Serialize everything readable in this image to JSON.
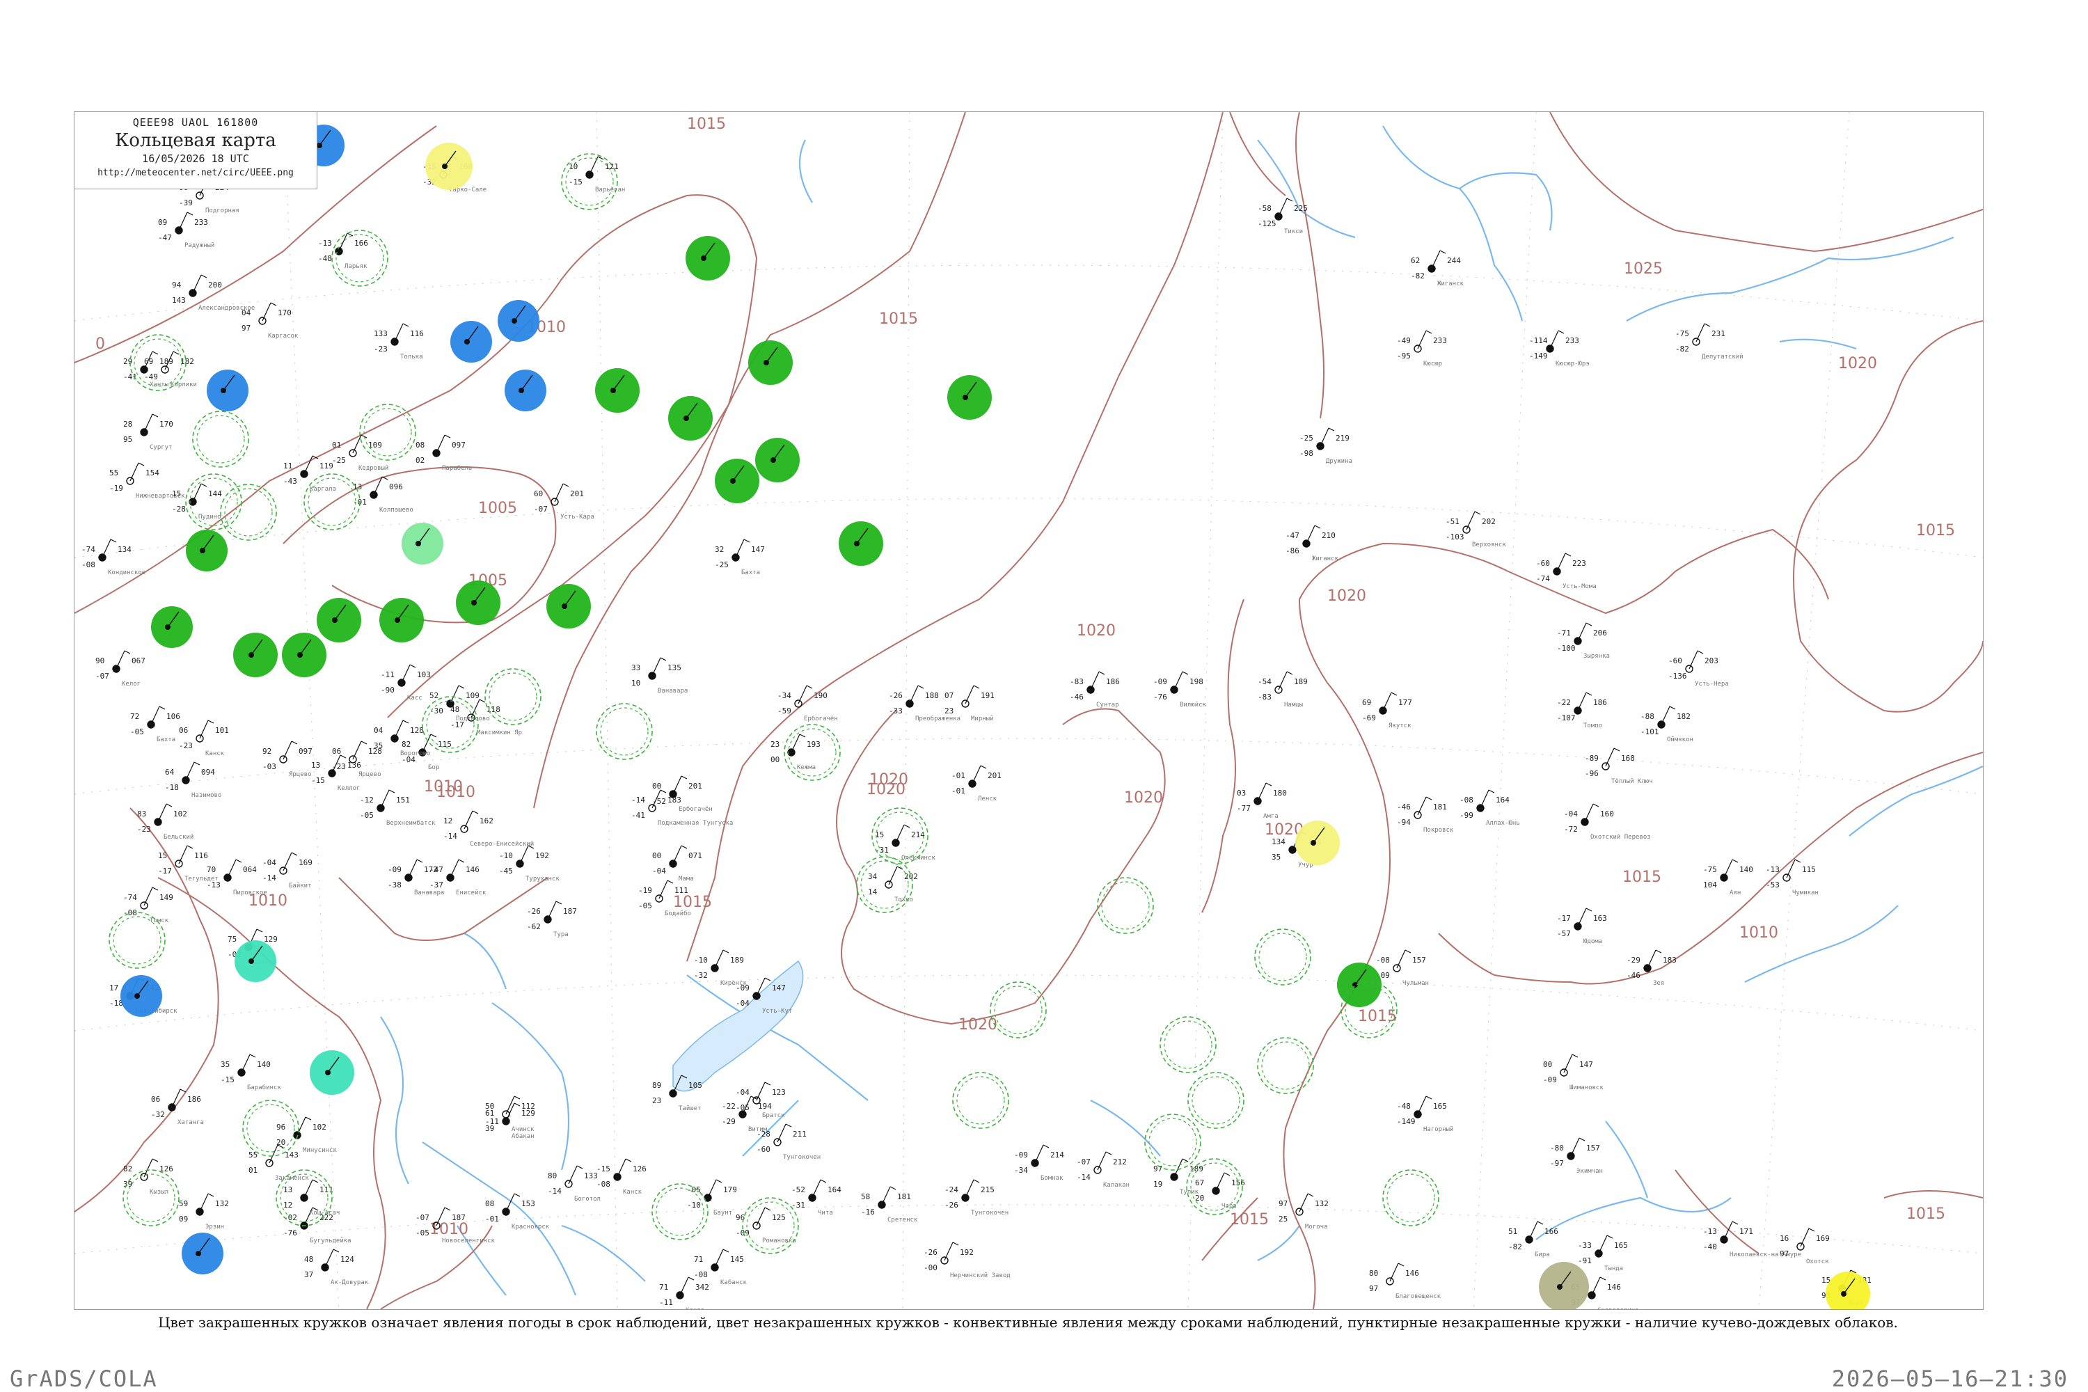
{
  "header": {
    "code": "QEEE98  UAOL  161800",
    "title": "Кольцевая карта",
    "datetime": "16/05/2026 18 UTC",
    "url": "http://meteocenter.net/circ/UEEE.png"
  },
  "caption": "Цвет закрашенных кружков означает явления погоды в срок наблюдений, цвет незакрашенных кружков - конвективные явления между сроками наблюдений, пунктирные незакрашенные кружки - наличие кучево-дождевых облаков.",
  "footer": {
    "left": "GrADS/COLA",
    "right": "2026–05–16–21:30"
  },
  "colors": {
    "isobar": "#b5706a",
    "river": "#7ab8ee",
    "green": "#22b41c",
    "blue": "#2a86e6",
    "teal": "#3ee2b8",
    "light_green": "#7ee89a",
    "yellow": "#f4f27a",
    "bright_yellow": "#f7f22a",
    "olive": "#b4b48a",
    "dashed_ring": "#3cb43c"
  },
  "isobar_labels": [
    "1015",
    "1010",
    "1005",
    "1005",
    "1010",
    "1015",
    "1020",
    "1020",
    "1020",
    "1020",
    "1025",
    "1020",
    "1015",
    "1015",
    "1010",
    "1015",
    "1015",
    "1015",
    "1010",
    "1010",
    "1015",
    "1020",
    "1020",
    "1010",
    "0",
    "1020"
  ],
  "filled_stations": [
    {
      "kind": "green"
    },
    {
      "kind": "green"
    },
    {
      "kind": "green"
    },
    {
      "kind": "green"
    },
    {
      "kind": "green"
    },
    {
      "kind": "green"
    },
    {
      "kind": "green"
    },
    {
      "kind": "green"
    },
    {
      "kind": "green"
    },
    {
      "kind": "green"
    },
    {
      "kind": "green"
    },
    {
      "kind": "green"
    },
    {
      "kind": "green"
    },
    {
      "kind": "green"
    },
    {
      "kind": "green"
    },
    {
      "kind": "green"
    },
    {
      "kind": "green"
    },
    {
      "kind": "blue"
    },
    {
      "kind": "blue"
    },
    {
      "kind": "blue"
    },
    {
      "kind": "blue"
    },
    {
      "kind": "blue"
    },
    {
      "kind": "blue"
    },
    {
      "kind": "blue"
    },
    {
      "kind": "teal"
    },
    {
      "kind": "teal"
    },
    {
      "kind": "light_green"
    },
    {
      "kind": "yellow"
    },
    {
      "kind": "yellow"
    },
    {
      "kind": "bright_yellow"
    },
    {
      "kind": "olive"
    }
  ],
  "ring_stations": [
    {
      "kind": "dashed"
    },
    {
      "kind": "dashed"
    },
    {
      "kind": "dashed"
    },
    {
      "kind": "dashed"
    },
    {
      "kind": "dashed"
    },
    {
      "kind": "dashed"
    },
    {
      "kind": "dashed"
    },
    {
      "kind": "dashed"
    },
    {
      "kind": "dashed"
    },
    {
      "kind": "dashed"
    },
    {
      "kind": "dashed"
    },
    {
      "kind": "dashed"
    },
    {
      "kind": "dashed"
    },
    {
      "kind": "dashed"
    },
    {
      "kind": "dashed"
    },
    {
      "kind": "dashed"
    },
    {
      "kind": "dashed"
    },
    {
      "kind": "dashed"
    },
    {
      "kind": "dashed"
    },
    {
      "kind": "dashed"
    },
    {
      "kind": "dashed"
    },
    {
      "kind": "dashed"
    },
    {
      "kind": "dashed"
    },
    {
      "kind": "dashed"
    },
    {
      "kind": "dashed"
    },
    {
      "kind": "dashed"
    },
    {
      "kind": "dashed"
    },
    {
      "kind": "dashed"
    },
    {
      "kind": "dashed"
    },
    {
      "kind": "dashed"
    },
    {
      "kind": "dashed"
    }
  ],
  "stations": [
    {
      "press": "224",
      "temp": "06",
      "dew": "-39",
      "name": "Подгорная"
    },
    {
      "press": "233",
      "temp": "09",
      "dew": "-47",
      "name": "Радужный"
    },
    {
      "press": "200",
      "temp": "94",
      "dew": "143",
      "name": "Александровское"
    },
    {
      "press": "170",
      "temp": "04",
      "dew": "97",
      "name": "Каргасок"
    },
    {
      "press": "189",
      "temp": "29",
      "dew": "-41",
      "name": "Ханты"
    },
    {
      "press": "170",
      "temp": "28",
      "dew": "95",
      "name": "Сургут"
    },
    {
      "press": "154",
      "temp": "55",
      "dew": "-19",
      "name": "Нижневартовск"
    },
    {
      "press": "134",
      "temp": "-74",
      "dew": "-08",
      "name": "Кондинское"
    },
    {
      "press": "121",
      "temp": "10",
      "dew": "-15",
      "name": "Варьёган"
    },
    {
      "press": "160",
      "temp": "-15",
      "dew": "-32",
      "name": "Тарко-Сале"
    },
    {
      "press": "116",
      "temp": "133",
      "dew": "-23",
      "name": "Толька"
    },
    {
      "press": "166",
      "temp": "-13",
      "dew": "-48",
      "name": "Ларьяк"
    },
    {
      "press": "182",
      "temp": "69",
      "dew": "-49",
      "name": "Корлики"
    },
    {
      "press": "144",
      "temp": "15",
      "dew": "-28",
      "name": "Пудино"
    },
    {
      "press": "119",
      "temp": "11",
      "dew": "-43",
      "name": "Каргала"
    },
    {
      "press": "109",
      "temp": "01",
      "dew": "-25",
      "name": "Кедровый"
    },
    {
      "press": "097",
      "temp": "08",
      "dew": "02",
      "name": "Парабель"
    },
    {
      "press": "096",
      "temp": "13",
      "dew": "-01",
      "name": "Колпашево"
    },
    {
      "press": "201",
      "temp": "60",
      "dew": "-07",
      "name": "Усть-Кара"
    },
    {
      "press": "147",
      "temp": "32",
      "dew": "-25",
      "name": "Бахта"
    },
    {
      "press": "135",
      "temp": "33",
      "dew": "10",
      "name": "Ванавара"
    },
    {
      "press": "190",
      "temp": "-34",
      "dew": "-59",
      "name": "Ербогачён"
    },
    {
      "press": "193",
      "temp": "23",
      "dew": "00",
      "name": "Кежма"
    },
    {
      "press": "188",
      "temp": "-26",
      "dew": "-33",
      "name": "Преображенка"
    },
    {
      "press": "191",
      "temp": "07",
      "dew": "23",
      "name": "Мирный"
    },
    {
      "press": "201",
      "temp": "-01",
      "dew": "-01",
      "name": "Ленск"
    },
    {
      "press": "214",
      "temp": "15",
      "dew": "-31",
      "name": "Олёкминск"
    },
    {
      "press": "202",
      "temp": "34",
      "dew": "14",
      "name": "Токко"
    },
    {
      "press": "186",
      "temp": "-83",
      "dew": "-46",
      "name": "Сунтар"
    },
    {
      "press": "198",
      "temp": "-09",
      "dew": "-76",
      "name": "Вилюйск"
    },
    {
      "press": "189",
      "temp": "-54",
      "dew": "-83",
      "name": "Намцы"
    },
    {
      "press": "177",
      "temp": "69",
      "dew": "-69",
      "name": "Якутск"
    },
    {
      "press": "244",
      "temp": "62",
      "dew": "-82",
      "name": "Жиганск"
    },
    {
      "press": "233",
      "temp": "-49",
      "dew": "-95",
      "name": "Кюсюр"
    },
    {
      "press": "225",
      "temp": "-58",
      "dew": "-125",
      "name": "Тикси"
    },
    {
      "press": "233",
      "temp": "-114",
      "dew": "-149",
      "name": "Кюсюр-Юрэ"
    },
    {
      "press": "231",
      "temp": "-75",
      "dew": "-82",
      "name": "Депутатский"
    },
    {
      "press": "219",
      "temp": "-25",
      "dew": "-98",
      "name": "Дружина"
    },
    {
      "press": "210",
      "temp": "-47",
      "dew": "-86",
      "name": "Жиганск"
    },
    {
      "press": "202",
      "temp": "-51",
      "dew": "-103",
      "name": "Верхоянск"
    },
    {
      "press": "223",
      "temp": "-60",
      "dew": "-74",
      "name": "Усть-Мома"
    },
    {
      "press": "206",
      "temp": "-71",
      "dew": "-100",
      "name": "Зырянка"
    },
    {
      "press": "203",
      "temp": "-60",
      "dew": "-136",
      "name": "Усть-Нера"
    },
    {
      "press": "186",
      "temp": "-22",
      "dew": "-107",
      "name": "Томпо"
    },
    {
      "press": "182",
      "temp": "-88",
      "dew": "-101",
      "name": "Оймякон"
    },
    {
      "press": "168",
      "temp": "-89",
      "dew": "-96",
      "name": "Тёплый Ключ"
    },
    {
      "press": "160",
      "temp": "-04",
      "dew": "-72",
      "name": "Охотский Перевоз"
    },
    {
      "press": "164",
      "temp": "-08",
      "dew": "-99",
      "name": "Аллах-Юнь"
    },
    {
      "press": "181",
      "temp": "-46",
      "dew": "-94",
      "name": "Покровск"
    },
    {
      "press": "180",
      "temp": "03",
      "dew": "-77",
      "name": "Амга"
    },
    {
      "press": "134",
      "temp": "134",
      "dew": "35",
      "name": "Учур"
    },
    {
      "press": "157",
      "temp": "-08",
      "dew": "-09",
      "name": "Чульман"
    },
    {
      "press": "165",
      "temp": "-48",
      "dew": "-149",
      "name": "Нагорный"
    },
    {
      "press": "140",
      "temp": "-75",
      "dew": "104",
      "name": "Аян"
    },
    {
      "press": "115",
      "temp": "-13",
      "dew": "-53",
      "name": "Чумикан"
    },
    {
      "press": "163",
      "temp": "-17",
      "dew": "-57",
      "name": "Юдома"
    },
    {
      "press": "183",
      "temp": "-29",
      "dew": "-46",
      "name": "Зея"
    },
    {
      "press": "147",
      "temp": "00",
      "dew": "-09",
      "name": "Шимановск"
    },
    {
      "press": "157",
      "temp": "-80",
      "dew": "-97",
      "name": "Экимчан"
    },
    {
      "press": "171",
      "temp": "-13",
      "dew": "-40",
      "name": "Николаевск-на-Амуре"
    },
    {
      "press": "169",
      "temp": "16",
      "dew": "97",
      "name": "Охотск"
    },
    {
      "press": "181",
      "temp": "15",
      "dew": "93",
      "name": "Иман"
    },
    {
      "press": "166",
      "temp": "51",
      "dew": "-82",
      "name": "Бира"
    },
    {
      "press": "146",
      "temp": "80",
      "dew": "97",
      "name": "Благовещенск"
    },
    {
      "press": "165",
      "temp": "-33",
      "dew": "-91",
      "name": "Тында"
    },
    {
      "press": "146",
      "temp": "65",
      "dew": "97",
      "name": "Сковородино"
    },
    {
      "press": "132",
      "temp": "97",
      "dew": "25",
      "name": "Могоча"
    },
    {
      "press": "156",
      "temp": "67",
      "dew": "20",
      "name": "Чара"
    },
    {
      "press": "189",
      "temp": "97",
      "dew": "19",
      "name": "Тупик"
    },
    {
      "press": "212",
      "temp": "-07",
      "dew": "-14",
      "name": "Калакан"
    },
    {
      "press": "214",
      "temp": "-09",
      "dew": "-34",
      "name": "Бомнак"
    },
    {
      "press": "215",
      "temp": "-24",
      "dew": "-26",
      "name": "Тунгокочен"
    },
    {
      "press": "192",
      "temp": "-26",
      "dew": "-00",
      "name": "Нерчинский Завод"
    },
    {
      "press": "181",
      "temp": "58",
      "dew": "-16",
      "name": "Сретенск"
    },
    {
      "press": "164",
      "temp": "-52",
      "dew": "-31",
      "name": "Чита"
    },
    {
      "press": "211",
      "temp": "-28",
      "dew": "-60",
      "name": "Тунгокочен"
    },
    {
      "press": "194",
      "temp": "-22",
      "dew": "-29",
      "name": "Витим"
    },
    {
      "press": "179",
      "temp": "-05",
      "dew": "-10",
      "name": "Баунт"
    },
    {
      "press": "125",
      "temp": "96",
      "dew": "-09",
      "name": "Романовка"
    },
    {
      "press": "145",
      "temp": "71",
      "dew": "-08",
      "name": "Кабанск"
    },
    {
      "press": "342",
      "temp": "71",
      "dew": "-11",
      "name": "Кяхта"
    },
    {
      "press": "143",
      "temp": "55",
      "dew": "01",
      "name": "Закаменск"
    },
    {
      "press": "124",
      "temp": "48",
      "dew": "37",
      "name": "Ак-Довурак"
    },
    {
      "press": "132",
      "temp": "59",
      "dew": "09",
      "name": "Эрзин"
    },
    {
      "press": "126",
      "temp": "82",
      "dew": "39",
      "name": "Кызыл"
    },
    {
      "press": "186",
      "temp": "06",
      "dew": "-32",
      "name": "Хатанга"
    },
    {
      "press": "222",
      "temp": "-02",
      "dew": "-76",
      "name": "Бугульдейка"
    },
    {
      "press": "187",
      "temp": "-07",
      "dew": "-05",
      "name": "Новоселенгинск"
    },
    {
      "press": "102",
      "temp": "96",
      "dew": "20",
      "name": "Минусинск"
    },
    {
      "press": "111",
      "temp": "13",
      "dew": "12",
      "name": "Кош-Агач"
    },
    {
      "press": "112",
      "temp": "50",
      "dew": "-11",
      "name": "Ачинск"
    },
    {
      "press": "129",
      "temp": "61",
      "dew": "39",
      "name": "Абакан"
    },
    {
      "press": "153",
      "temp": "08",
      "dew": "-01",
      "name": "Красноярск"
    },
    {
      "press": "133",
      "temp": "80",
      "dew": "-14",
      "name": "Боготол"
    },
    {
      "press": "126",
      "temp": "-15",
      "dew": "-08",
      "name": "Канск"
    },
    {
      "press": "105",
      "temp": "89",
      "dew": "23",
      "name": "Тайшет"
    },
    {
      "press": "123",
      "temp": "-04",
      "dew": "-05",
      "name": "Братск"
    },
    {
      "press": "147",
      "temp": "-09",
      "dew": "-04",
      "name": "Усть-Кут"
    },
    {
      "press": "189",
      "temp": "-10",
      "dew": "-32",
      "name": "Киренск"
    },
    {
      "press": "111",
      "temp": "-19",
      "dew": "-05",
      "name": "Бодайбо"
    },
    {
      "press": "071",
      "temp": "00",
      "dew": "-04",
      "name": "Мама"
    },
    {
      "press": "201",
      "temp": "00",
      "dew": "-52",
      "name": "Ербогачён"
    },
    {
      "press": "183",
      "temp": "-14",
      "dew": "-41",
      "name": "Подкаменная Тунгуска"
    },
    {
      "press": "192",
      "temp": "-10",
      "dew": "-45",
      "name": "Туруханск"
    },
    {
      "press": "187",
      "temp": "-26",
      "dew": "-62",
      "name": "Тура"
    },
    {
      "press": "169",
      "temp": "-04",
      "dew": "-14",
      "name": "Байкит"
    },
    {
      "press": "172",
      "temp": "-09",
      "dew": "-38",
      "name": "Ванавара"
    },
    {
      "press": "146",
      "temp": "-47",
      "dew": "-37",
      "name": "Енисейск"
    },
    {
      "press": "162",
      "temp": "12",
      "dew": "-14",
      "name": "Северо-Енисейский"
    },
    {
      "press": "151",
      "temp": "-12",
      "dew": "-05",
      "name": "Верхнеимбатск"
    },
    {
      "press": "136",
      "temp": "13",
      "dew": "-15",
      "name": "Келлог"
    },
    {
      "press": "128",
      "temp": "06",
      "dew": "-23",
      "name": "Ярцево"
    },
    {
      "press": "115",
      "temp": "82",
      "dew": "-04",
      "name": "Бор"
    },
    {
      "press": "128",
      "temp": "04",
      "dew": "35",
      "name": "Ворогово"
    },
    {
      "press": "118",
      "temp": "48",
      "dew": "-17",
      "name": "Максимкин Яр"
    },
    {
      "press": "103",
      "temp": "-11",
      "dew": "-90",
      "name": "Касс"
    },
    {
      "press": "109",
      "temp": "52",
      "dew": "-30",
      "name": "Подтесово"
    },
    {
      "press": "097",
      "temp": "92",
      "dew": "-03",
      "name": "Ярцево"
    },
    {
      "press": "067",
      "temp": "90",
      "dew": "-07",
      "name": "Келог"
    },
    {
      "press": "106",
      "temp": "72",
      "dew": "-05",
      "name": "Бахта"
    },
    {
      "press": "101",
      "temp": "06",
      "dew": "-23",
      "name": "Канск"
    },
    {
      "press": "094",
      "temp": "64",
      "dew": "-18",
      "name": "Назимово"
    },
    {
      "press": "102",
      "temp": "83",
      "dew": "-23",
      "name": "Бельский"
    },
    {
      "press": "116",
      "temp": "15",
      "dew": "-17",
      "name": "Тегульдет"
    },
    {
      "press": "064",
      "temp": "70",
      "dew": "-13",
      "name": "Пировское"
    },
    {
      "press": "129",
      "temp": "75",
      "dew": "-02",
      "name": "Бакчар"
    },
    {
      "press": "149",
      "temp": "-74",
      "dew": "-08",
      "name": "Томск"
    },
    {
      "press": "142",
      "temp": "17",
      "dew": "-18",
      "name": "Новосибирск"
    },
    {
      "press": "140",
      "temp": "35",
      "dew": "-15",
      "name": "Барабинск"
    },
    {
      "press": "162",
      "temp": "12",
      "dew": "-14",
      "name": "Купино"
    },
    {
      "press": "156",
      "temp": "30",
      "dew": "-17",
      "name": "Татарск"
    },
    {
      "press": "136",
      "temp": "49",
      "dew": "17",
      "name": "Камень-на-Оби"
    },
    {
      "press": "126",
      "temp": "-33",
      "dew": "-29",
      "name": "Барнаул"
    },
    {
      "press": "097",
      "temp": "-05",
      "dew": "-26",
      "name": "Славгород"
    },
    {
      "press": "154",
      "temp": "-01",
      "dew": "-04",
      "name": "Бийск"
    },
    {
      "press": "112",
      "temp": "-04",
      "dew": "-10",
      "name": "Змеиногорск"
    }
  ]
}
